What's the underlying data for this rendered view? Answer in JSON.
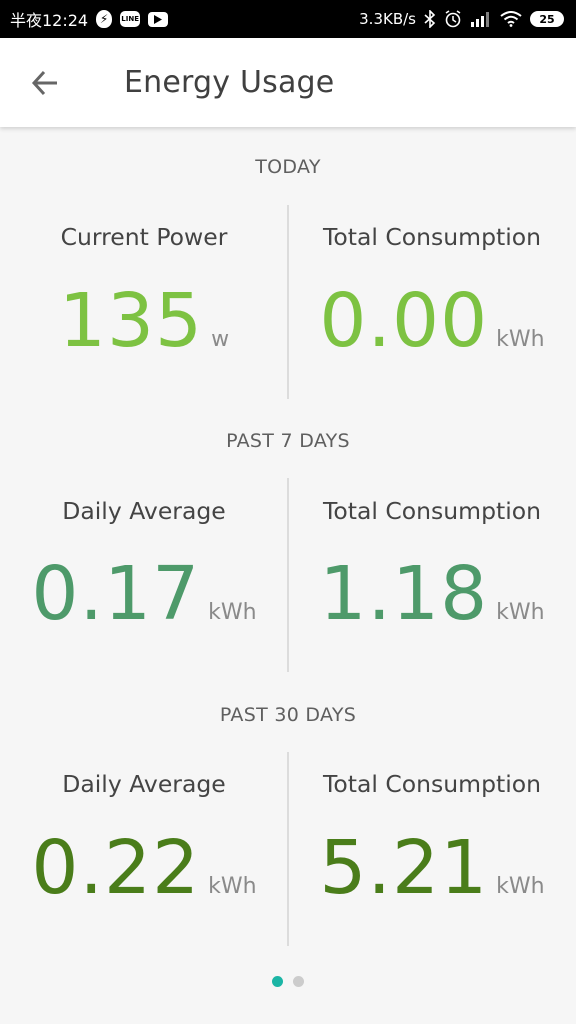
{
  "status_bar": {
    "time": "半夜12:24",
    "network_speed": "3.3KB/s",
    "battery": "25",
    "icons": [
      "bolt-icon",
      "line-app-icon",
      "youtube-icon",
      "bluetooth-icon",
      "alarm-icon",
      "signal-icon",
      "wifi-icon",
      "battery-icon"
    ],
    "line_label": "LINE"
  },
  "appbar": {
    "title": "Energy Usage",
    "back_icon": "arrow-left-icon"
  },
  "sections": [
    {
      "label": "TODAY",
      "left": {
        "label": "Current Power",
        "value": "135",
        "unit": "w"
      },
      "right": {
        "label": "Total Consumption",
        "value": "0.00",
        "unit": "kWh"
      },
      "color": "#7dc242"
    },
    {
      "label": "PAST 7 DAYS",
      "left": {
        "label": "Daily Average",
        "value": "0.17",
        "unit": "kWh"
      },
      "right": {
        "label": "Total Consumption",
        "value": "1.18",
        "unit": "kWh"
      },
      "color": "#4e9a6a"
    },
    {
      "label": "PAST 30 DAYS",
      "left": {
        "label": "Daily Average",
        "value": "0.22",
        "unit": "kWh"
      },
      "right": {
        "label": "Total Consumption",
        "value": "5.21",
        "unit": "kWh"
      },
      "color": "#4a7d1a"
    }
  ],
  "pager": {
    "active_color": "#1bb5a5",
    "inactive_color": "#cccccc",
    "pages": 2,
    "current": 1
  }
}
